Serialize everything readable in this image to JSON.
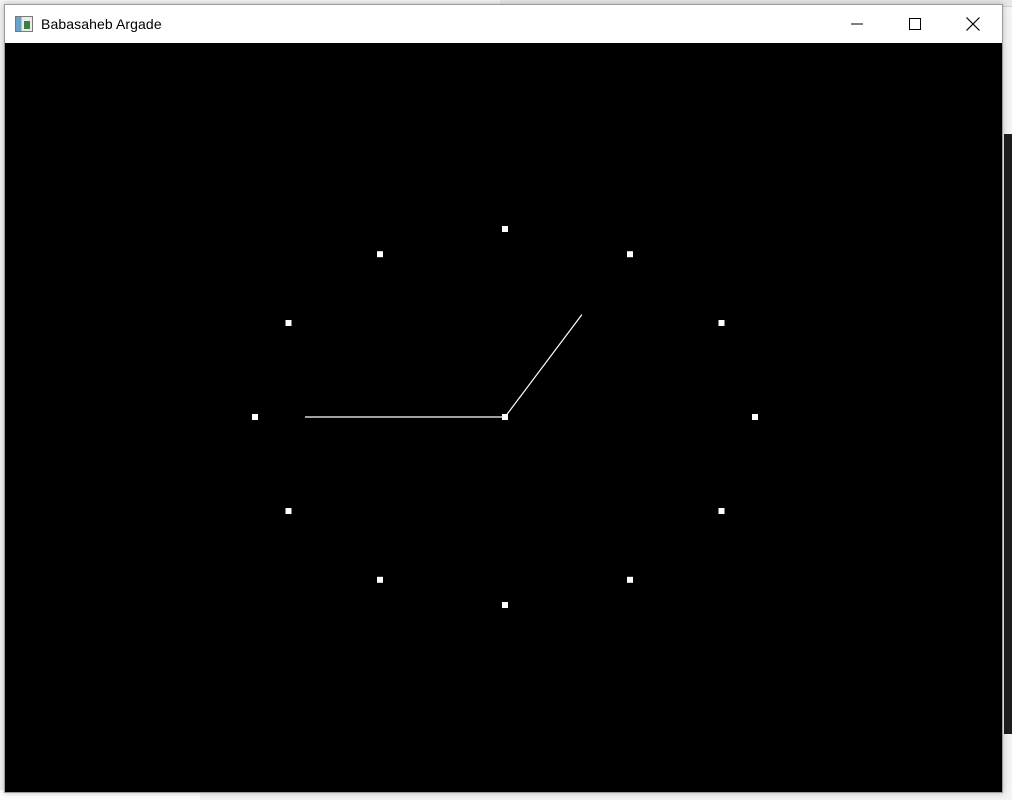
{
  "window": {
    "title": "Babasaheb Argade",
    "icon": "app-window-icon",
    "controls": [
      {
        "name": "minimize-button",
        "icon": "minimize-icon"
      },
      {
        "name": "maximize-button",
        "icon": "maximize-icon"
      },
      {
        "name": "close-button",
        "icon": "close-icon"
      }
    ]
  },
  "canvas": {
    "background": "#000000",
    "foreground": "#ffffff",
    "clock": {
      "hour_markers": 12,
      "hand_1_angle_deg": 270,
      "hand_2_angle_deg": 36.9
    }
  }
}
